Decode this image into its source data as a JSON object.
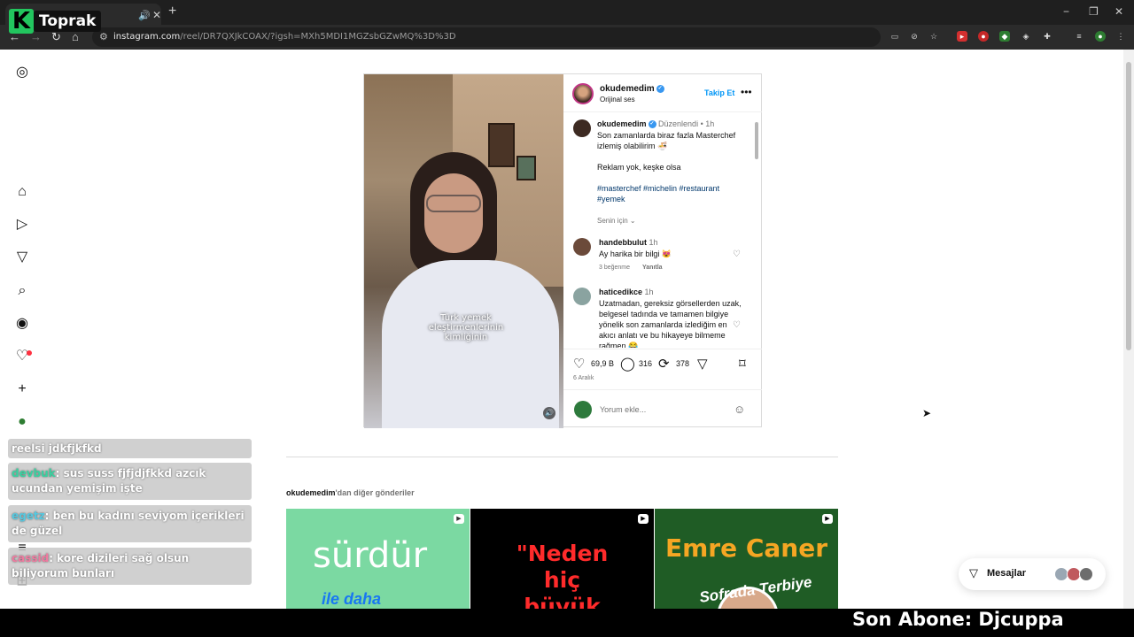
{
  "browser": {
    "tab_audio_icon": "speaker-icon",
    "close_glyph": "✕",
    "new_tab_glyph": "+",
    "window_controls": [
      "−",
      "❐",
      "✕"
    ],
    "url_domain": "instagram.com",
    "url_path": "/reel/DR7QXJkCOAX/?igsh=MXh5MDI1MGZsbGZwMQ%3D%3D"
  },
  "overlay": {
    "brand_letter": "K",
    "brand_name": "Toprak",
    "last_subscriber": "Son Abone: Djcuppa"
  },
  "chat": {
    "messages": [
      {
        "user": "",
        "text": "reelsi jdkfjkfkd"
      },
      {
        "user": "devbuk",
        "text": ": sus suss fjfjdjfkkd azcık ucundan yemişim işte"
      },
      {
        "user": "egetz",
        "text": ": ben bu kadını seviyom içerikleri de güzel"
      },
      {
        "user": "cassid",
        "text": ": kore dizileri sağ olsun biliyorum bunları"
      }
    ]
  },
  "post": {
    "username": "okudemedim",
    "audio": "Orijinal ses",
    "follow_label": "Takip Et",
    "caption_overlay": "Türk yemek eleştirmenlerinin kimliğinin",
    "description": {
      "meta": "Düzenlendi • 1h",
      "line1": "Son zamanlarda biraz fazla Masterchef izlemiş olabilirim 🍜",
      "line2": "Reklam yok, keşke olsa",
      "hashtags": "#masterchef #michelin #restaurant #yemek",
      "for_you": "Senin için"
    },
    "comments": [
      {
        "user": "handebbulut",
        "time": "1h",
        "text": "Ay harika bir bilgi 😻",
        "likes": "3 beğenme",
        "reply": "Yanıtla"
      },
      {
        "user": "haticedikce",
        "time": "1h",
        "text": "Uzatmadan, gereksiz görsellerden uzak, belgesel tadında ve tamamen bilgiye yönelik son zamanlarda izlediğim en akıcı anlatı ve bu hikayeye bilmeme rağmen 😂"
      }
    ],
    "likes": "69,9 B",
    "comment_count": "316",
    "reposts": "378",
    "date": "6 Aralık",
    "comment_placeholder": "Yorum ekle..."
  },
  "more_posts": {
    "user": "okudemedim",
    "suffix": "'dan diğer gönderiler",
    "thumbs": [
      {
        "title": "sürdür",
        "subtitle": "ile daha"
      },
      {
        "line1": "\"Neden",
        "line2": "hiç",
        "line3": "büyük"
      },
      {
        "title": "Emre Caner",
        "subtitle": "Sofrada Terbiye"
      }
    ]
  },
  "messages_label": "Mesajlar",
  "colors": {
    "accent": "#0095f6",
    "chrome_bg": "#2b2b2b",
    "notification": "#ff3040"
  }
}
